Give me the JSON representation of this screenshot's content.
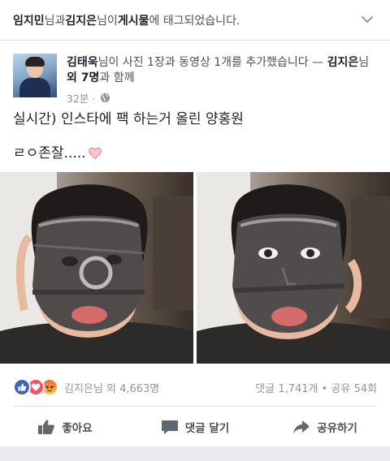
{
  "tagline": {
    "user1": "임지민",
    "and": "님과 ",
    "user2": "김지은",
    "was": "님이 ",
    "target": "게시물",
    "suffix": "에 태그되었습니다."
  },
  "post": {
    "author": "김태욱",
    "action": "님이 사진 1장과 동영상 1개를 추가했습니다 — ",
    "with_user": "김지은",
    "with_suffix1": "님",
    "with_others": "외 7명",
    "with_suffix2": "과 함께",
    "time": "32분 · ",
    "text_line1": "실시간) 인스타에 팩 하는거 올린 양홍원",
    "text_line2": "ㄹㅇ존잘....."
  },
  "reactions": {
    "names": "김지은님 외 4,663명",
    "counts": "댓글 1,741개 • 공유 54회"
  },
  "actions": {
    "like": "좋아요",
    "comment": "댓글 달기",
    "share": "공유하기"
  },
  "colors": {
    "like_blue": "#4267b2",
    "love_red": "#f25268",
    "text_gray": "#90949c"
  },
  "icons": [
    "chevron-down-icon",
    "globe-icon",
    "heart-emoji-icon",
    "like-reaction-icon",
    "love-reaction-icon",
    "angry-reaction-icon",
    "thumbs-up-icon",
    "comment-icon",
    "share-icon"
  ]
}
